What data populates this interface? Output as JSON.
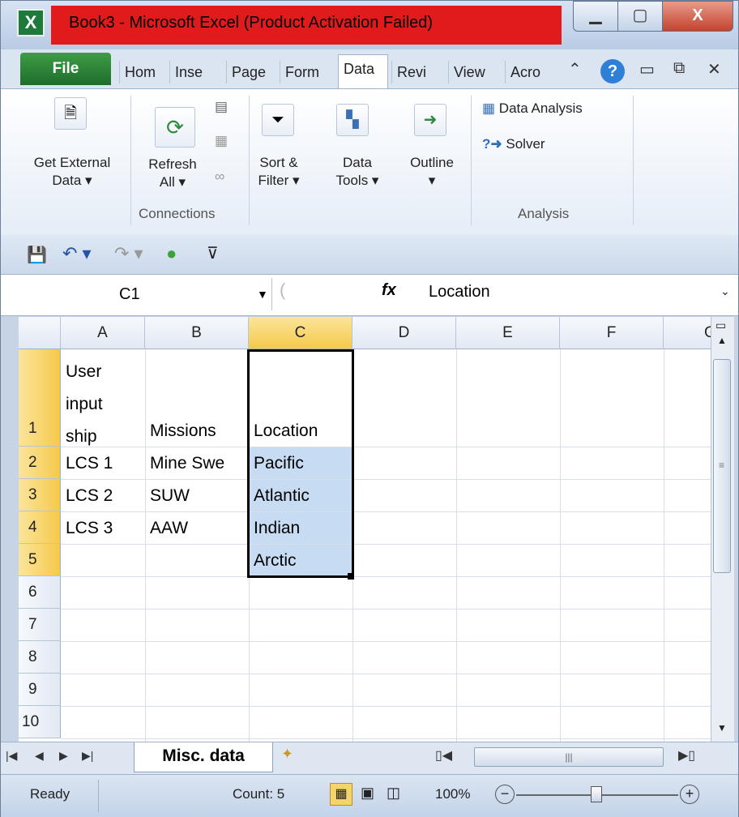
{
  "title_bar": {
    "app_icon": "X",
    "title": "Book3 - Microsoft Excel (Product Activation Failed)",
    "minimize": "▁",
    "maximize": "▢",
    "close": "X"
  },
  "ribbon_tabs": {
    "file": "File",
    "tabs": [
      "Hom",
      "Inse",
      "Page",
      "Form",
      "Data",
      "Revi",
      "View",
      "Acro"
    ],
    "active": "Data"
  },
  "ribbon": {
    "get_external_data": [
      "Get External",
      "Data ▾"
    ],
    "refresh_all": [
      "Refresh",
      "All ▾"
    ],
    "connections_group": "Connections",
    "sort_filter": [
      "Sort &",
      "Filter ▾"
    ],
    "data_tools": [
      "Data",
      "Tools ▾"
    ],
    "outline": [
      "Outline",
      "▾"
    ],
    "data_analysis": "Data Analysis",
    "solver": "Solver",
    "analysis_group": "Analysis"
  },
  "formula_bar": {
    "name_box": "C1",
    "fx": "fx",
    "value": "Location"
  },
  "columns": [
    "A",
    "B",
    "C",
    "D",
    "E",
    "F",
    "G"
  ],
  "rows": [
    "1",
    "2",
    "3",
    "4",
    "5",
    "6",
    "7",
    "8",
    "9",
    "10"
  ],
  "cells": {
    "A1": [
      "User",
      "input",
      "ship"
    ],
    "B1": "Missions",
    "C1": "Location",
    "A2": "LCS 1",
    "B2": "Mine Swe",
    "C2": "Pacific",
    "A3": "LCS 2",
    "B3": "SUW",
    "C3": "Atlantic",
    "A4": "LCS 3",
    "B4": "AAW",
    "C4": "Indian",
    "C5": "Arctic"
  },
  "sheet_tab": "Misc. data",
  "status_bar": {
    "ready": "Ready",
    "count": "Count: 5",
    "zoom": "100%"
  }
}
